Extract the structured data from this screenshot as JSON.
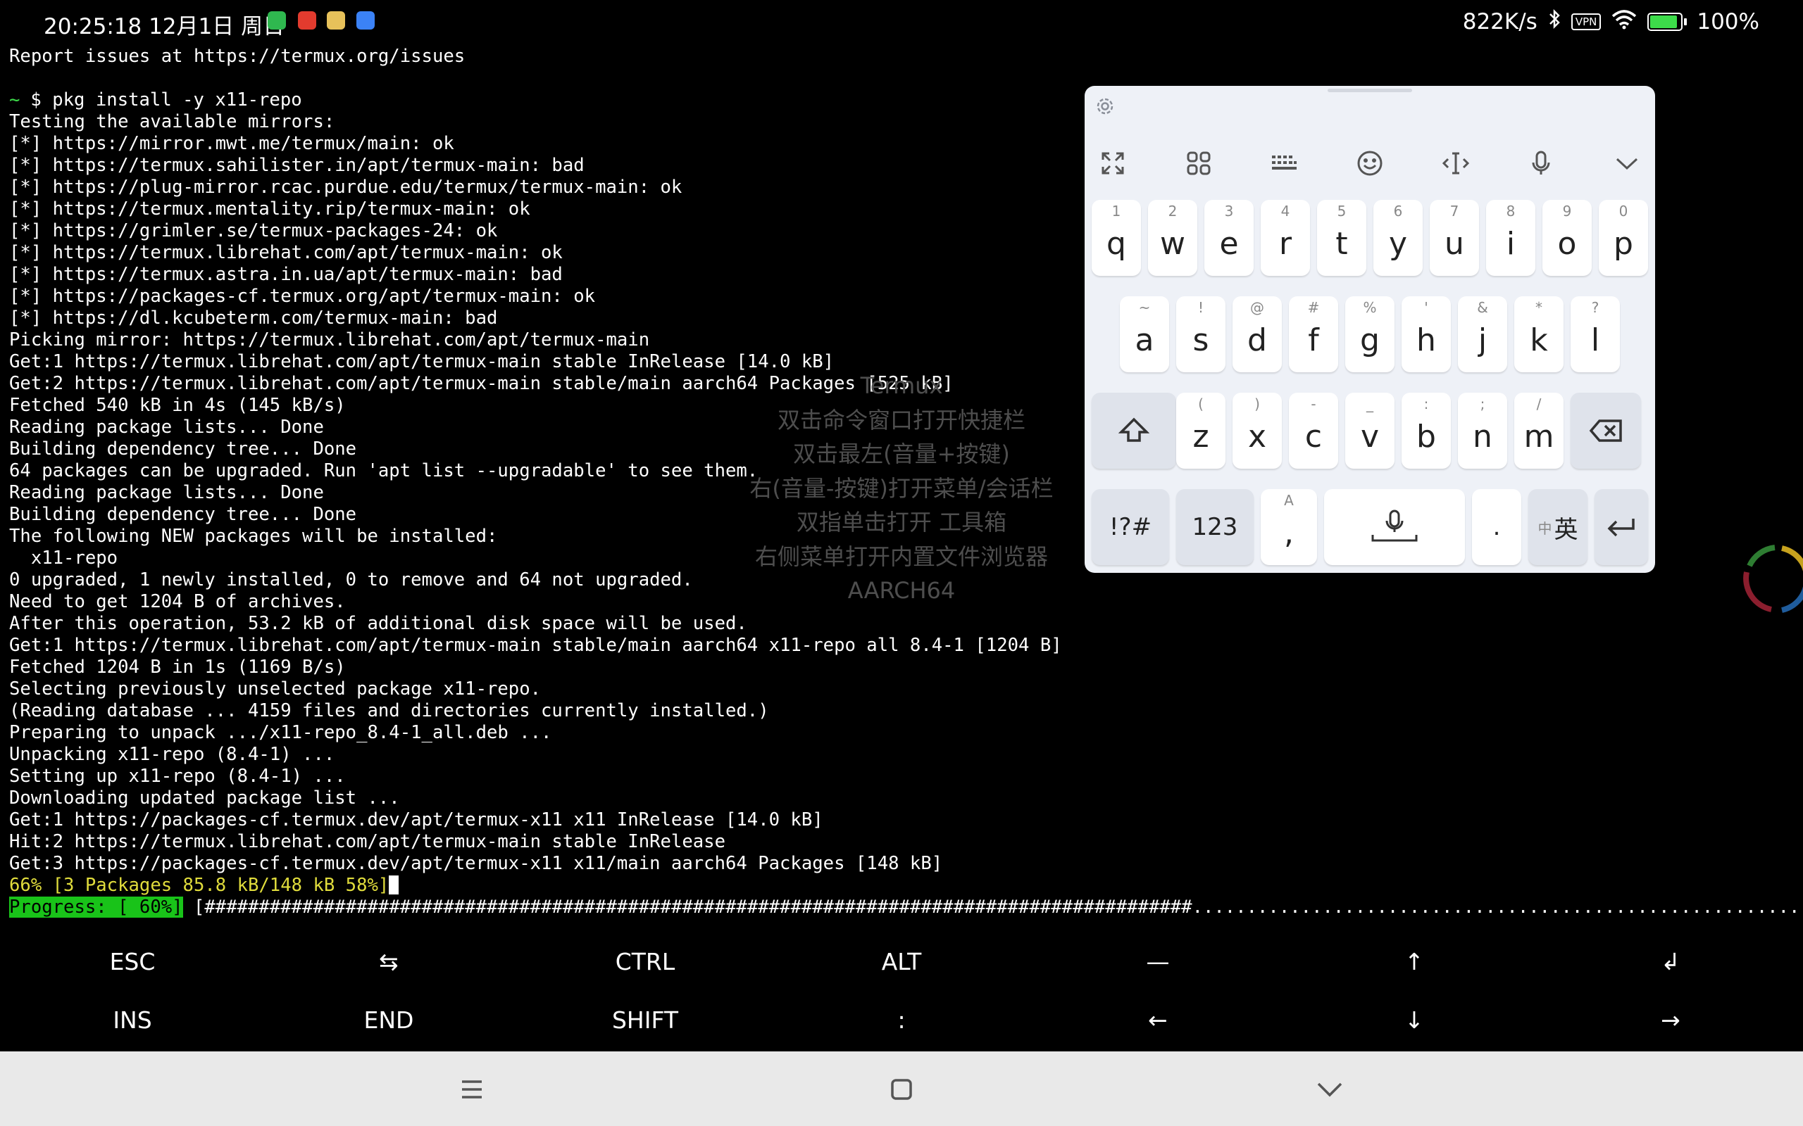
{
  "status_bar": {
    "time": "20:25:18 12月1日 周日",
    "net_speed": "822K/s",
    "vpn_label": "VPN",
    "battery": "100%",
    "battery_level": 1.0,
    "app_icons": [
      {
        "name": "shield-app-icon",
        "color": "#2fb84f"
      },
      {
        "name": "video-app-icon",
        "color": "#e23b2e"
      },
      {
        "name": "bear-app-icon",
        "color": "#e7c15a"
      },
      {
        "name": "calendar-app-icon",
        "color": "#3b82f6"
      }
    ]
  },
  "terminal": {
    "lines": [
      "Report issues at https://termux.org/issues",
      "",
      "$ pkg install -y x11-repo",
      "Testing the available mirrors:",
      "[*] https://mirror.mwt.me/termux/main: ok",
      "[*] https://termux.sahilister.in/apt/termux-main: bad",
      "[*] https://plug-mirror.rcac.purdue.edu/termux/termux-main: ok",
      "[*] https://termux.mentality.rip/termux-main: ok",
      "[*] https://grimler.se/termux-packages-24: ok",
      "[*] https://termux.librehat.com/apt/termux-main: ok",
      "[*] https://termux.astra.in.ua/apt/termux-main: bad",
      "[*] https://packages-cf.termux.org/apt/termux-main: ok",
      "[*] https://dl.kcubeterm.com/termux-main: bad",
      "Picking mirror: https://termux.librehat.com/apt/termux-main",
      "Get:1 https://termux.librehat.com/apt/termux-main stable InRelease [14.0 kB]",
      "Get:2 https://termux.librehat.com/apt/termux-main stable/main aarch64 Packages [525 kB]",
      "Fetched 540 kB in 4s (145 kB/s)",
      "Reading package lists... Done",
      "Building dependency tree... Done",
      "64 packages can be upgraded. Run 'apt list --upgradable' to see them.",
      "Reading package lists... Done",
      "Building dependency tree... Done",
      "The following NEW packages will be installed:",
      "  x11-repo",
      "0 upgraded, 1 newly installed, 0 to remove and 64 not upgraded.",
      "Need to get 1204 B of archives.",
      "After this operation, 53.2 kB of additional disk space will be used.",
      "Get:1 https://termux.librehat.com/apt/termux-main stable/main aarch64 x11-repo all 8.4-1 [1204 B]",
      "Fetched 1204 B in 1s (1169 B/s)",
      "Selecting previously unselected package x11-repo.",
      "(Reading database ... 4159 files and directories currently installed.)",
      "Preparing to unpack .../x11-repo_8.4-1_all.deb ...",
      "Unpacking x11-repo (8.4-1) ...",
      "Setting up x11-repo (8.4-1) ...",
      "Downloading updated package list ...",
      "Get:1 https://packages-cf.termux.dev/apt/termux-x11 x11 InRelease [14.0 kB]",
      "Hit:2 https://termux.librehat.com/apt/termux-main stable InRelease",
      "Get:3 https://packages-cf.termux.dev/apt/termux-x11 x11/main aarch64 Packages [148 kB]"
    ],
    "prompt_symbol": "~",
    "download_status": "66% [3 Packages 85.8 kB/148 kB 58%]",
    "progress_label": "Progress: [ 60%]",
    "progress_bar": "[###########################################################################################...........................................................]"
  },
  "watermark": {
    "lines": [
      "Termux",
      "双击命令窗口打开快捷栏",
      "双击最左(音量+按键)",
      "右(音量-按键)打开菜单/会话栏",
      "双指单击打开 工具箱",
      "右侧菜单打开内置文件浏览器",
      "AARCH64"
    ]
  },
  "keyboard": {
    "row1": [
      {
        "k": "q",
        "h": "1"
      },
      {
        "k": "w",
        "h": "2"
      },
      {
        "k": "e",
        "h": "3"
      },
      {
        "k": "r",
        "h": "4"
      },
      {
        "k": "t",
        "h": "5"
      },
      {
        "k": "y",
        "h": "6"
      },
      {
        "k": "u",
        "h": "7"
      },
      {
        "k": "i",
        "h": "8"
      },
      {
        "k": "o",
        "h": "9"
      },
      {
        "k": "p",
        "h": "0"
      }
    ],
    "row2": [
      {
        "k": "a",
        "h": "~"
      },
      {
        "k": "s",
        "h": "!"
      },
      {
        "k": "d",
        "h": "@"
      },
      {
        "k": "f",
        "h": "#"
      },
      {
        "k": "g",
        "h": "%"
      },
      {
        "k": "h",
        "h": "'"
      },
      {
        "k": "j",
        "h": "&"
      },
      {
        "k": "k",
        "h": "*"
      },
      {
        "k": "l",
        "h": "?"
      }
    ],
    "row3": [
      {
        "k": "z",
        "h": "("
      },
      {
        "k": "x",
        "h": ")"
      },
      {
        "k": "c",
        "h": "-"
      },
      {
        "k": "v",
        "h": "_"
      },
      {
        "k": "b",
        "h": ":"
      },
      {
        "k": "n",
        "h": ";"
      },
      {
        "k": "m",
        "h": "/"
      }
    ],
    "symbols_label": "!?#",
    "numbers_label": "123",
    "comma_label": ",",
    "comma_hint": "A",
    "period_label": ".",
    "lang_small": "中",
    "lang_big": "英"
  },
  "extra_keys": {
    "row1": [
      "ESC",
      "⇆",
      "CTRL",
      "ALT",
      "—",
      "↑",
      "↲"
    ],
    "row2": [
      "INS",
      "END",
      "SHIFT",
      ":",
      "←",
      "↓",
      "→"
    ]
  }
}
